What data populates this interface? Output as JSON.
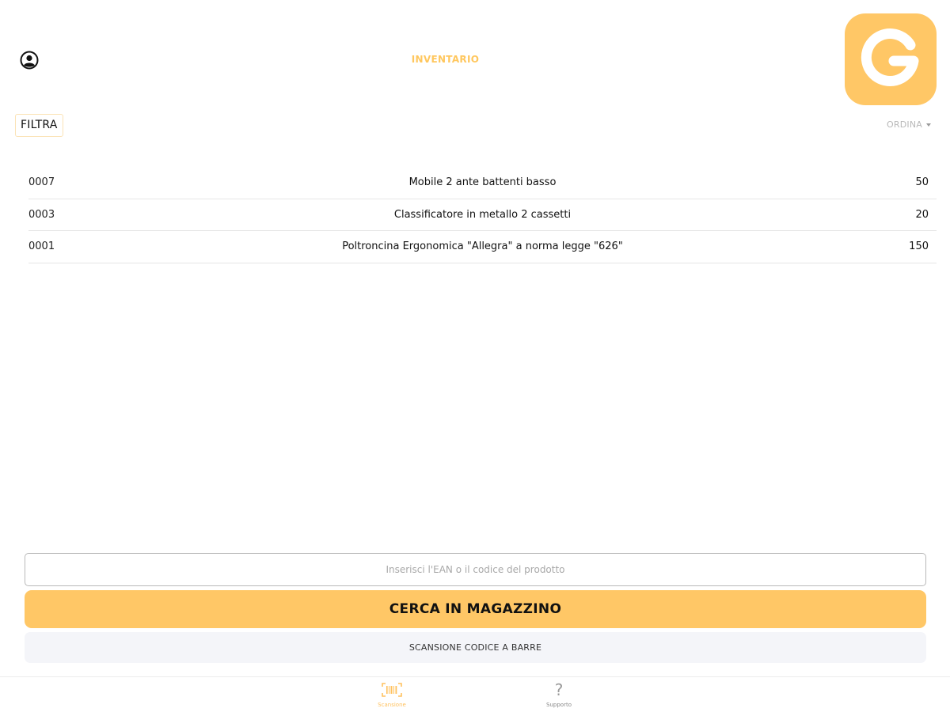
{
  "header": {
    "title": "INVENTARIO",
    "profile_icon": "user-circle-icon",
    "logo_letter": "G"
  },
  "toolbar": {
    "filter_label": "FILTRA",
    "sort_label": "ORDINA",
    "sort_icon": "caret-down-icon"
  },
  "products": [
    {
      "code": "0007",
      "name": "Mobile 2 ante battenti basso",
      "qty": "50"
    },
    {
      "code": "0003",
      "name": "Classificatore in metallo 2 cassetti",
      "qty": "20"
    },
    {
      "code": "0001",
      "name": "Poltroncina Ergonomica \"Allegra\" a norma legge \"626\"",
      "qty": "150"
    }
  ],
  "search": {
    "placeholder": "Inserisci l'EAN o il codice del prodotto",
    "value": ""
  },
  "actions": {
    "search_label": "CERCA IN MAGAZZINO",
    "scan_label": "SCANSIONE CODICE A BARRE"
  },
  "tabs": [
    {
      "label": "Scansione",
      "icon": "barcode-scan-icon",
      "active": true
    },
    {
      "label": "Supporto",
      "icon": "question-icon",
      "active": false
    }
  ],
  "colors": {
    "accent": "#ffc766",
    "accent_text": "#ffc75e",
    "secondary_button": "#f4f5f9"
  }
}
